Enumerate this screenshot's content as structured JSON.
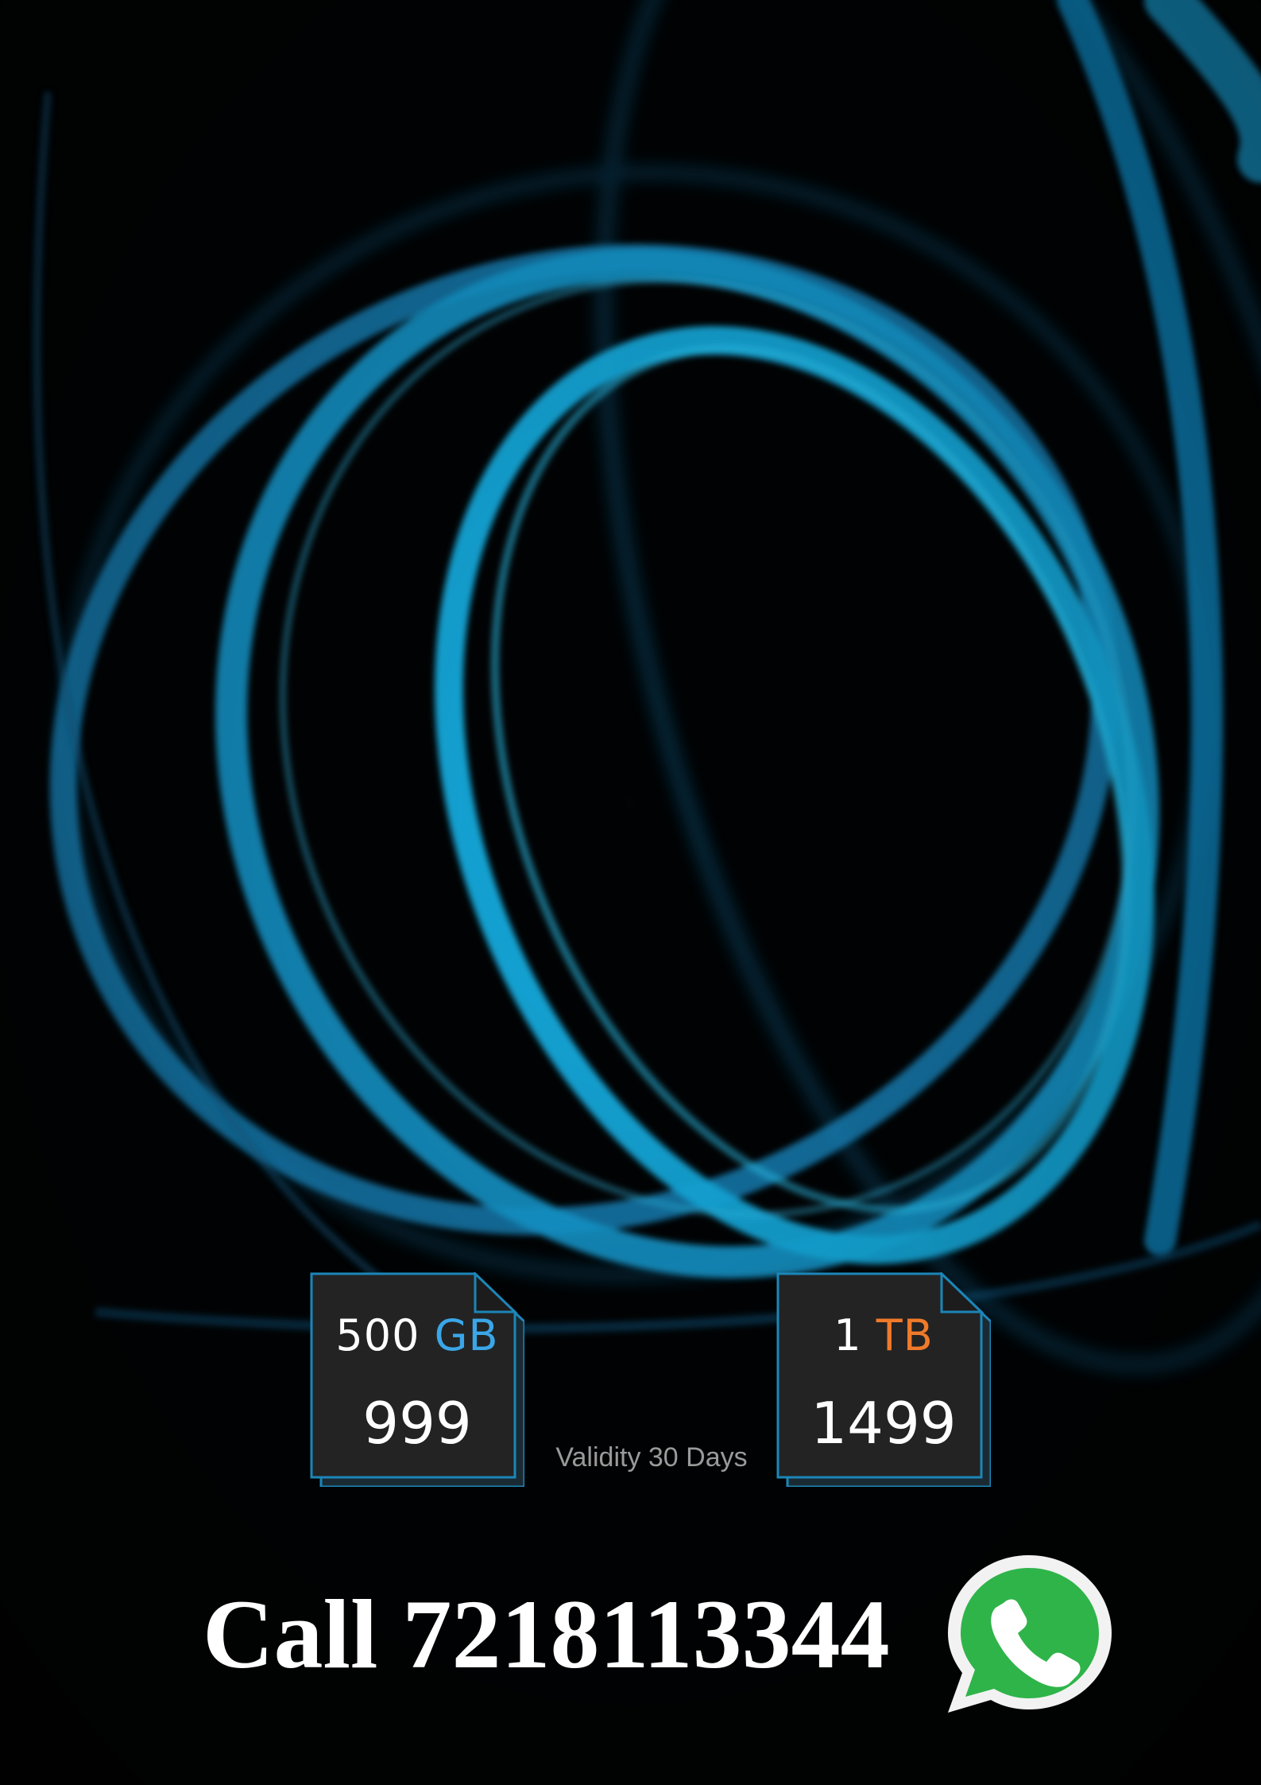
{
  "plans": [
    {
      "amount": "500",
      "unit": "GB",
      "price": "999",
      "unit_color": "#3aa6e8"
    },
    {
      "amount": "1",
      "unit": "TB",
      "price": "1499",
      "unit_color": "#f07a2a"
    }
  ],
  "validity": "Validity 30 Days",
  "call": "Call 7218113344",
  "icons": {
    "contact": "whatsapp-icon"
  },
  "colors": {
    "ring": "#14a7e0",
    "card_fill": "#232323",
    "card_border": "#1b86b8",
    "whatsapp": "#2fb44a"
  }
}
